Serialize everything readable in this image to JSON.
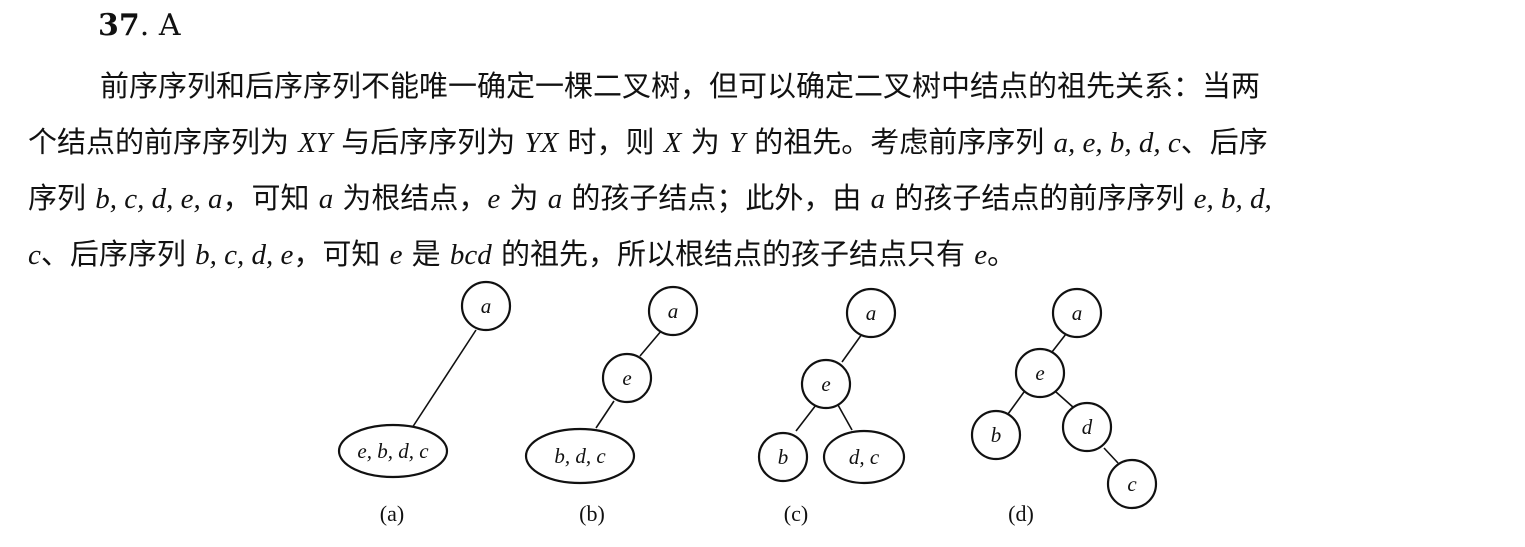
{
  "heading": {
    "number": "37",
    "sep": ".",
    "answer": "A"
  },
  "paragraph": {
    "lines": [
      [
        {
          "t": "前序序列和后序序列不能唯一确定一棵二叉树，但可以确定二叉树中结点的祖先关系：当两"
        }
      ],
      [
        {
          "t": "个结点的前序序列为 "
        },
        {
          "t": "XY",
          "i": true
        },
        {
          "t": " 与后序序列为 "
        },
        {
          "t": "YX",
          "i": true
        },
        {
          "t": " 时，则 "
        },
        {
          "t": "X",
          "i": true
        },
        {
          "t": " 为 "
        },
        {
          "t": "Y",
          "i": true
        },
        {
          "t": " 的祖先。考虑前序序列 "
        },
        {
          "t": "a, e, b, d, c",
          "i": true
        },
        {
          "t": "、后序"
        }
      ],
      [
        {
          "t": "序列 "
        },
        {
          "t": "b, c, d, e, a",
          "i": true
        },
        {
          "t": "，可知 "
        },
        {
          "t": "a",
          "i": true
        },
        {
          "t": " 为根结点，"
        },
        {
          "t": "e",
          "i": true
        },
        {
          "t": " 为 "
        },
        {
          "t": "a",
          "i": true
        },
        {
          "t": " 的孩子结点；此外，由 "
        },
        {
          "t": "a",
          "i": true
        },
        {
          "t": " 的孩子结点的前序序列 "
        },
        {
          "t": "e, b, d,",
          "i": true
        }
      ],
      [
        {
          "t": "c",
          "i": true
        },
        {
          "t": "、后序序列 "
        },
        {
          "t": "b, c, d, e",
          "i": true
        },
        {
          "t": "，可知 "
        },
        {
          "t": "e",
          "i": true
        },
        {
          "t": " 是 "
        },
        {
          "t": "bcd",
          "i": true
        },
        {
          "t": " 的祖先，所以根结点的孩子结点只有 "
        },
        {
          "t": "e",
          "i": true
        },
        {
          "t": "。"
        }
      ]
    ]
  },
  "figures": [
    {
      "caption": "(a)",
      "nodes": [
        {
          "label": "a"
        },
        {
          "label": "e, b, d, c"
        }
      ]
    },
    {
      "caption": "(b)",
      "nodes": [
        {
          "label": "a"
        },
        {
          "label": "e"
        },
        {
          "label": "b, d, c"
        }
      ]
    },
    {
      "caption": "(c)",
      "nodes": [
        {
          "label": "a"
        },
        {
          "label": "e"
        },
        {
          "label": "b"
        },
        {
          "label": "d, c"
        }
      ]
    },
    {
      "caption": "(d)",
      "nodes": [
        {
          "label": "a"
        },
        {
          "label": "e"
        },
        {
          "label": "b"
        },
        {
          "label": "d"
        },
        {
          "label": "c"
        }
      ]
    }
  ]
}
